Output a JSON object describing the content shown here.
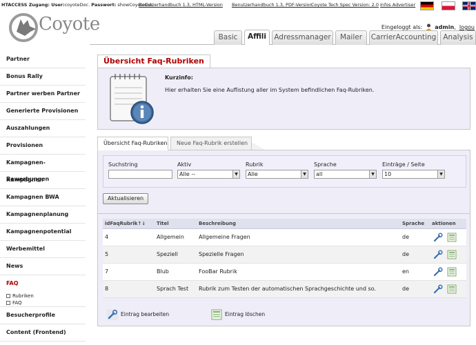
{
  "topbar": {
    "htaccess_prefix": "HTACCESS Zugang: User:",
    "htaccess_user": "coyoteDoc",
    "htaccess_pw_label": "Passwort:",
    "htaccess_pw": "showCoyoteDoc",
    "links": [
      "Benutzerhandbuch 1.3, HTML-Version",
      "Benutzerhandbuch 1.3, PDF-Version",
      "Coyote Tech Spec Version: 2.0",
      "Infos Advertiser"
    ],
    "flags": [
      "german-flag-icon",
      "polish-flag-icon",
      "english-flag-icon"
    ]
  },
  "header": {
    "logo_text": "Coyote",
    "login_label": "Eingeloggt als:",
    "username": "admin",
    "separator": ",",
    "logout": "logou"
  },
  "tabs": [
    "Basic",
    "Affili",
    "Adressmanager",
    "Mailer",
    "CarrierAccounting",
    "Analysis"
  ],
  "active_tab": "Affili",
  "sidebar": {
    "items": [
      "Partner",
      "Bonus Rally",
      "Partner werben Partner",
      "Generierte Provisionen",
      "Auszahlungen",
      "Provisionen",
      "Kampagnen-Bewerbungen",
      "Kampagnen",
      "Kampagnen BWA",
      "Kampagnenplanung",
      "Kampagnenpotential",
      "Werbemittel",
      "News",
      "FAQ",
      "Besucherprofile",
      "Content (Frontend)"
    ],
    "active": "FAQ",
    "faq_sub": [
      "Rubriken",
      "FAQ"
    ]
  },
  "page": {
    "title": "Übersicht Faq-Rubriken",
    "info_title": "Kurzinfo:",
    "info_text": "Hier erhalten Sie eine Auflistung aller im System befindlichen Faq-Rubriken."
  },
  "subtabs": [
    "Übersicht Faq-Rubriken",
    "Neue Faq-Rubrik erstellen"
  ],
  "filters": {
    "suchstring": {
      "label": "Suchstring",
      "value": ""
    },
    "aktiv": {
      "label": "Aktiv",
      "value": "Alle --"
    },
    "rubrik": {
      "label": "Rubrik",
      "value": "Alle"
    },
    "sprache": {
      "label": "Sprache",
      "value": "all"
    },
    "eintraege": {
      "label": "Einträge / Seite",
      "value": "10"
    },
    "button": "Aktualisieren"
  },
  "table": {
    "headers": {
      "id": "idFaqRubrik",
      "sort": "↑↓",
      "titel": "Titel",
      "beschreibung": "Beschreibung",
      "sprache": "Sprache",
      "aktionen": "aktionen"
    },
    "rows": [
      {
        "id": "4",
        "titel": "Allgemein",
        "beschreibung": "Allgemeine Fragen",
        "sprache": "de"
      },
      {
        "id": "5",
        "titel": "Speziell",
        "beschreibung": "Spezielle Fragen",
        "sprache": "de"
      },
      {
        "id": "7",
        "titel": "Blub",
        "beschreibung": "FooBar Rubrik",
        "sprache": "en"
      },
      {
        "id": "8",
        "titel": "Sprach Test",
        "beschreibung": "Rubrik zum Testen der automatischen Sprachgeschichte und so.",
        "sprache": "de"
      }
    ],
    "legend_edit": "Eintrag bearbeiten",
    "legend_delete": "Eintrag löschen"
  },
  "colors": {
    "accent_red": "#b00000",
    "panel_bg": "#eeedf8",
    "header_row": "#dfe1ee"
  }
}
